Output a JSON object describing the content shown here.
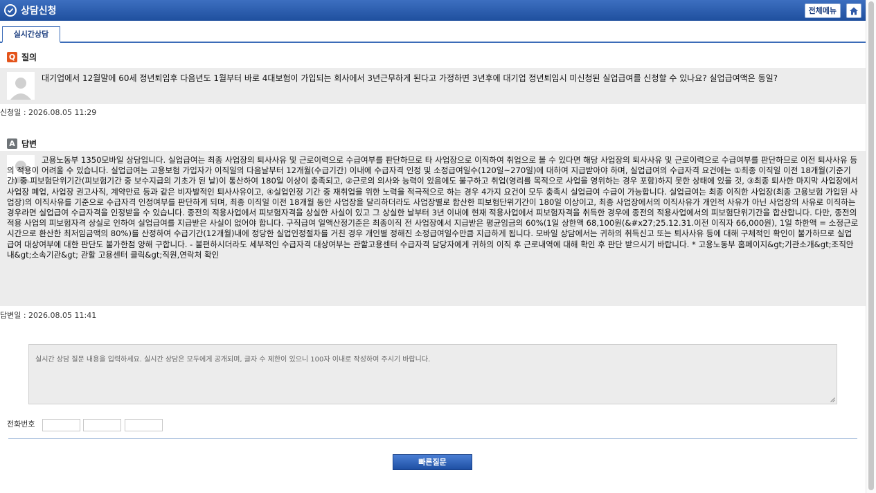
{
  "header": {
    "title": "상담신청",
    "all_menu_label": "전체메뉴",
    "home_icon": "home-icon",
    "check_icon": "check-circle-icon"
  },
  "tabs": [
    {
      "label": "실시간상담",
      "active": true
    }
  ],
  "question": {
    "section_label": "질의",
    "badge": "Q",
    "text": "대기업에서 12월말에 60세 정년퇴임후 다음년도 1월부터 바로 4대보험이 가입되는 회사에서 3년근무하게 된다고 가정하면 3년후에 대기업 정년퇴임시 미신청된 실업급여를 신청할 수 있나요? 실업급여액은 동일?",
    "date_label": "신청일 : 2026.08.05 11:29"
  },
  "answer": {
    "section_label": "답변",
    "badge": "A",
    "text": "고용노동부 1350모바일 상담입니다. 실업급여는 최종 사업장의 퇴사사유 및 근로이력으로 수급여부를 판단하므로 타 사업장으로 이직하여 취업으로 볼 수 있다면 해당 사업장의 퇴사사유 및 근로이력으로 수급여부를 판단하므로 이전 퇴사사유 등의 적용이 어려울 수 있습니다. 실업급여는 고용보험 가입자가 이직일의 다음날부터 12개월(수급기간) 이내에 수급자격 인정 및 소정급여일수(120일~270일)에 대하여 지급받아야 하며, 실업급여의 수급자격 요건에는 ①최종 이직일 이전 18개월(기준기간) 중 피보험단위기간(피보험기간 중 보수지급의 기초가 된 날)이 통산하여 180일 이상이 충족되고, ②근로의 의사와 능력이 있음에도 불구하고 취업(영리를 목적으로 사업을 영위하는 경우 포함)하지 못한 상태에 있을 것, ③최종 퇴사한 마지막 사업장에서 사업장 폐업, 사업장 권고사직, 계약만료 등과 같은 비자발적인 퇴사사유이고, ④실업인정 기간 중 재취업을 위한 노력을 적극적으로 하는 경우 4가지 요건이 모두 충족시 실업급여 수급이 가능합니다. 실업급여는 최종 이직한 사업장(최종 고용보험 가입된 사업장)의 이직사유를 기준으로 수급자격 인정여부를 판단하게 되며, 최종 이직일 이전 18개월 동안 사업장을 달리하더라도 사업장별로 합산한 피보험단위기간이 180일 이상이고, 최종 사업장에서의 이직사유가 개인적 사유가 아닌 사업장의 사유로 이직하는 경우라면 실업급여 수급자격을 인정받을 수 있습니다. 종전의 적용사업에서 피보험자격을 상실한 사실이 있고 그 상실한 날부터 3년 이내에 현재 적용사업에서 피보험자격을 취득한 경우에 종전의 적용사업에서의 피보험단위기간을 합산합니다. 다만, 종전의 적용 사업의 피보험자격 상실로 인하여 실업급여를 지급받은 사실이 없어야 합니다. 구직급여 일액산정기준은 최종이직 전 사업장에서 지급받은 평균임금의 60%(1일 상한액 68,100원(&#x27;25.12.31.이전 이직자 66,000원), 1일 하한액 = 소정근로시간으로 환산한 최저임금액의 80%)를 산정하여 수급기간(12개월)내에 정당한 실업인정절차를 거친 경우 개인별 정해진 소정급여일수만큼 지급하게 됩니다. 모바일 상담에서는 귀하의 취득신고 또는 퇴사사유 등에 대해 구체적인 확인이 불가하므로 실업급여 대상여부에 대한 판단도 불가한점 양해 구합니다. - 불편하시더라도 세부적인 수급자격 대상여부는 관할고용센터 수급자격 담당자에게 귀하의 이직 후 근로내역에 대해 확인 후 판단 받으시기 바랍니다. * 고용노동부 홈페이지&gt;기관소개&gt;조직안내&gt;소속기관&gt; 관할 고용센터 클릭&gt;직원,연락처 확인",
    "date_label": "답변일 : 2026.08.05 11:41"
  },
  "form": {
    "question_placeholder": "실시간 상담 질문 내용을 입력하세요. 실시간 상담은 모두에게 공개되며, 글자 수 제한이 있으니 100자 이내로 작성하여 주시기 바랍니다.",
    "phone_label": "전화번호",
    "phone_parts": [
      "",
      "",
      ""
    ],
    "submit_label": "빠른질문"
  }
}
